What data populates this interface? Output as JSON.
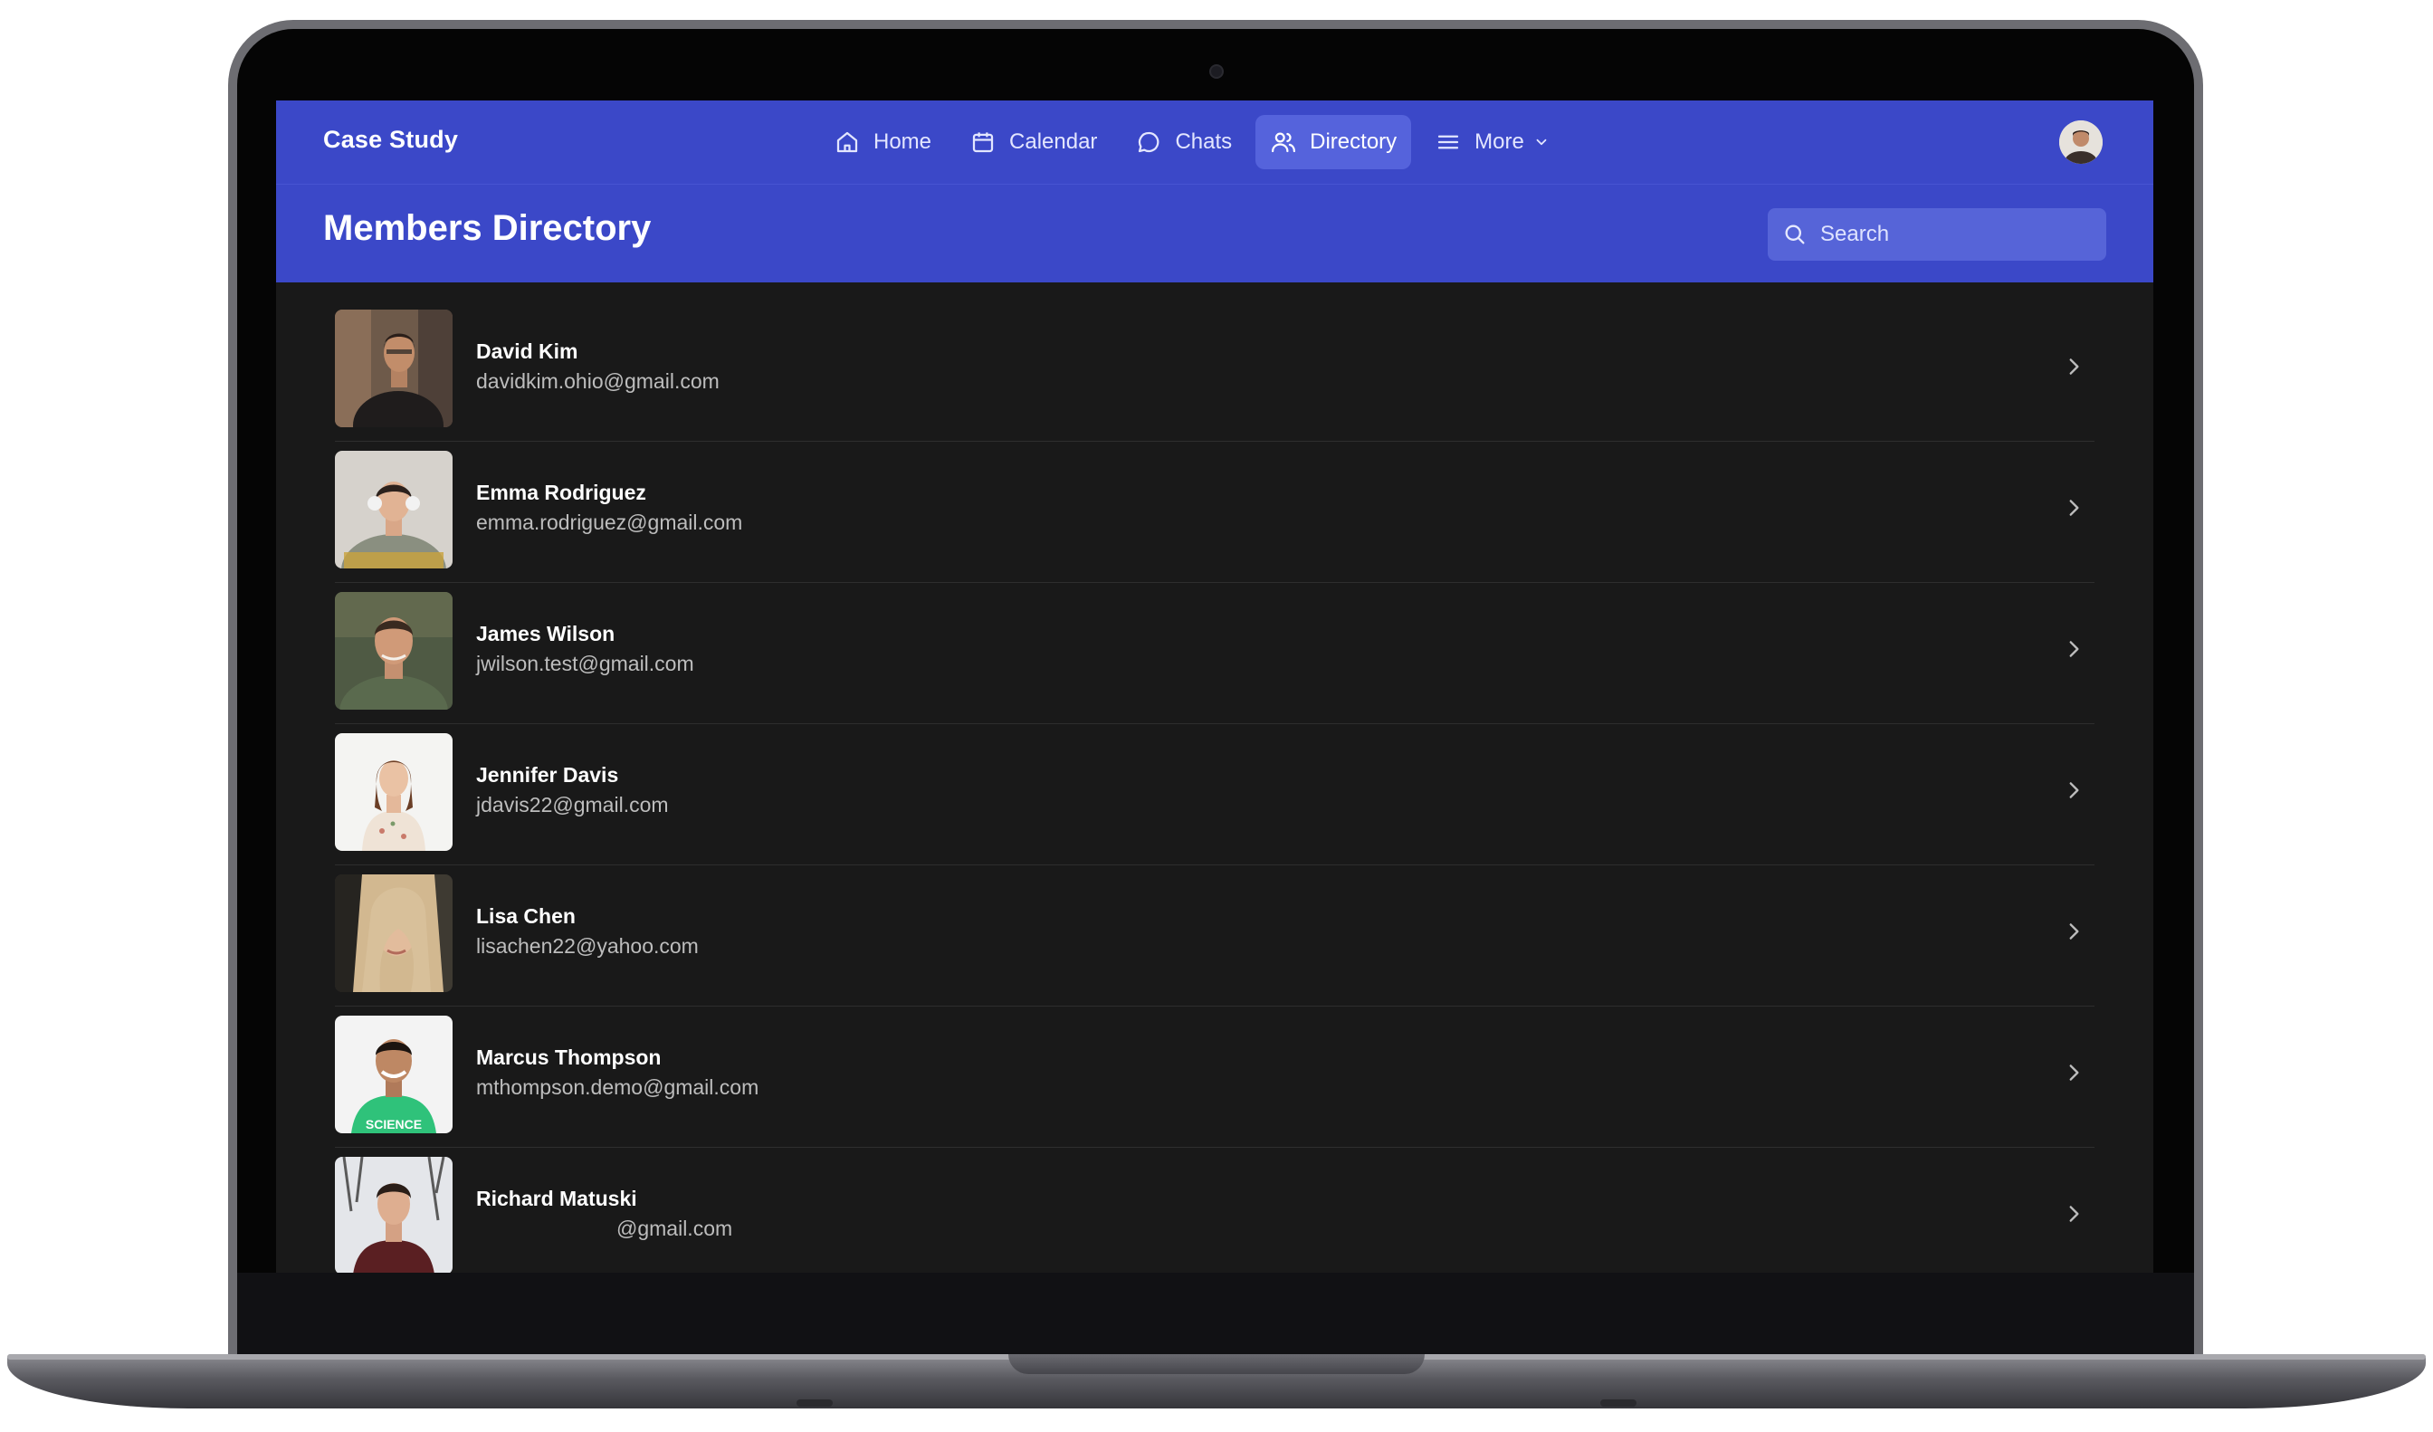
{
  "app": {
    "brand": "Case Study"
  },
  "nav": {
    "items": [
      {
        "label": "Home",
        "icon": "home-icon",
        "active": false
      },
      {
        "label": "Calendar",
        "icon": "calendar-icon",
        "active": false
      },
      {
        "label": "Chats",
        "icon": "chat-icon",
        "active": false
      },
      {
        "label": "Directory",
        "icon": "users-icon",
        "active": true
      },
      {
        "label": "More",
        "icon": "menu-icon",
        "active": false
      }
    ]
  },
  "header": {
    "title": "Members Directory",
    "search_placeholder": "Search"
  },
  "members": [
    {
      "name": "David Kim",
      "email": "davidkim.ohio@gmail.com"
    },
    {
      "name": "Emma Rodriguez",
      "email": "emma.rodriguez@gmail.com"
    },
    {
      "name": "James Wilson",
      "email": "jwilson.test@gmail.com"
    },
    {
      "name": "Jennifer Davis",
      "email": "jdavis22@gmail.com"
    },
    {
      "name": "Lisa Chen",
      "email": "lisachen22@yahoo.com"
    },
    {
      "name": "Marcus Thompson",
      "email": "mthompson.demo@gmail.com"
    },
    {
      "name": "Richard Matuski",
      "email": "@gmail.com"
    }
  ],
  "colors": {
    "accent": "#3b48c8",
    "active_nav": "#5563dc",
    "background": "#191919"
  }
}
